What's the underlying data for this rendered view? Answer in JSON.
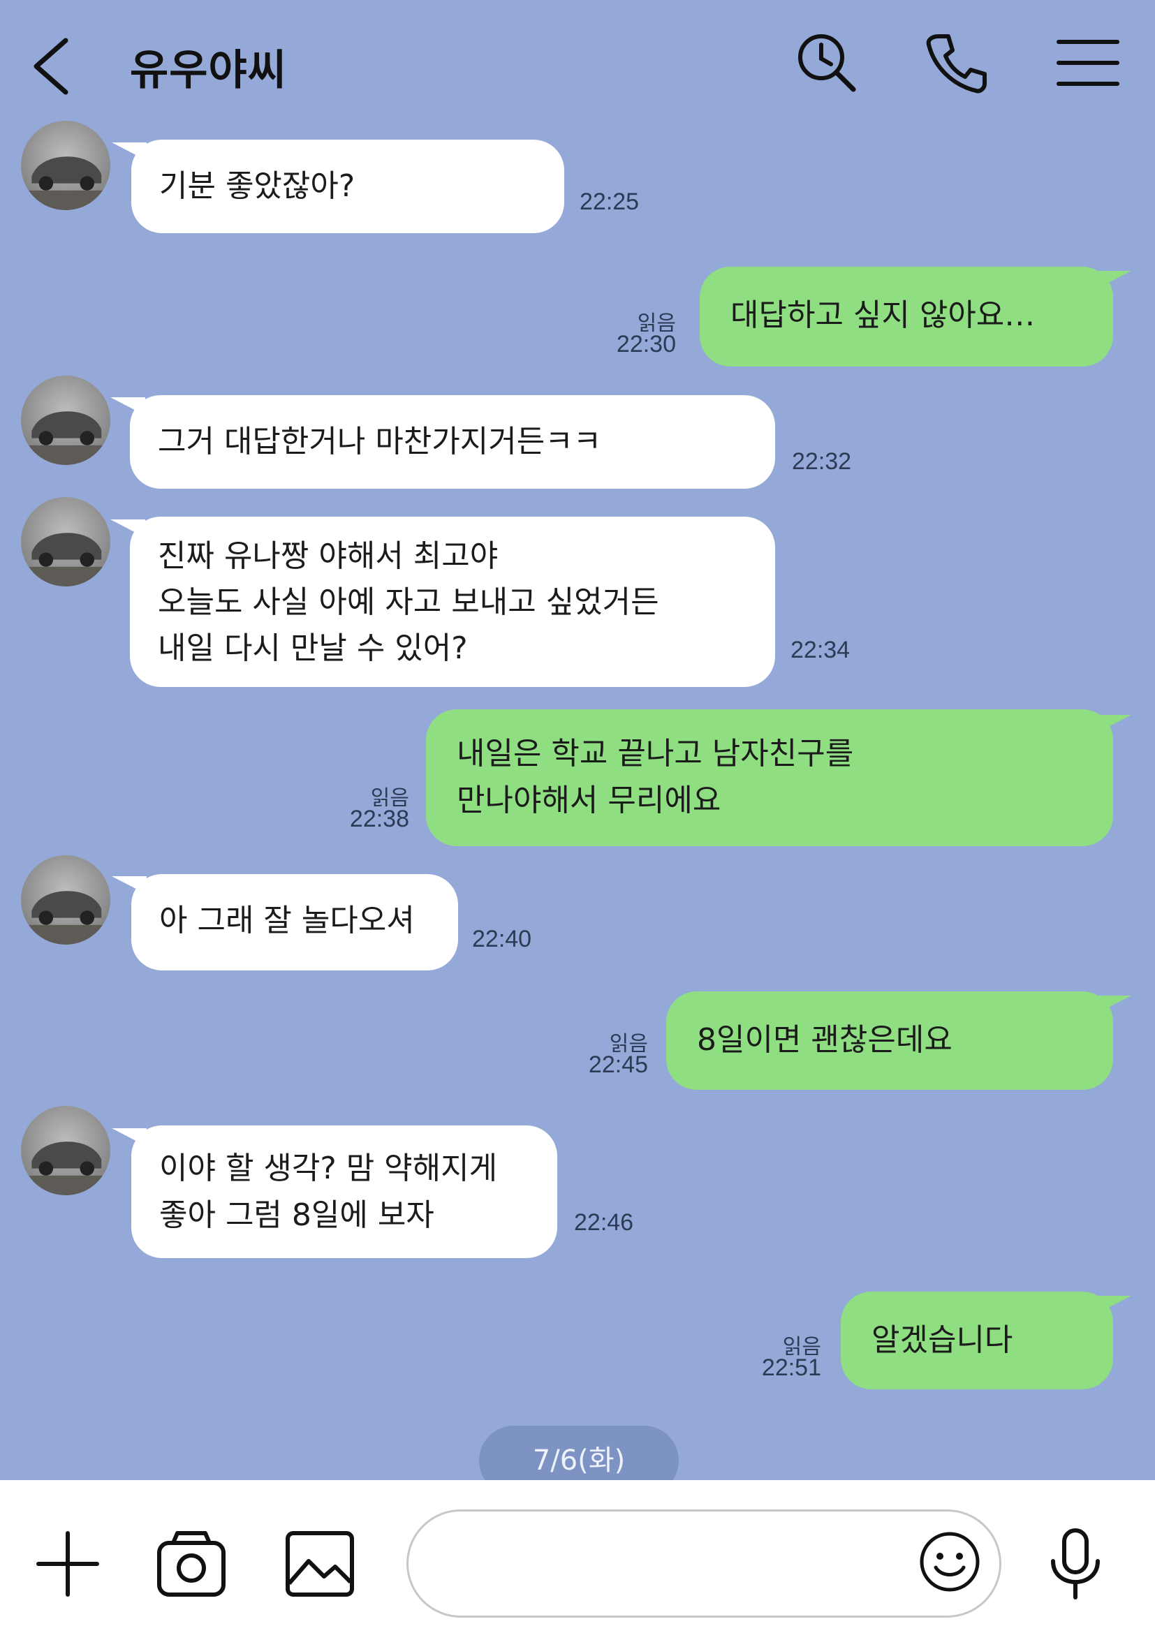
{
  "header": {
    "back_icon": "chevron-left-icon",
    "title": "유우야씨",
    "icons": [
      "search-clock-icon",
      "phone-icon",
      "menu-icon"
    ]
  },
  "messages": [
    {
      "side": "in",
      "text": "기분 좋았잖아?",
      "time": "22:25"
    },
    {
      "side": "out",
      "text": "대답하고 싶지 않아요…",
      "read": "읽음",
      "time": "22:30"
    },
    {
      "side": "in",
      "text": "그거 대답한거나 마찬가지거든ㅋㅋ",
      "time": "22:32"
    },
    {
      "side": "in",
      "text": "진짜 유나짱 야해서 최고야\n오늘도 사실 아예 자고 보내고 싶었거든\n내일 다시 만날 수 있어?",
      "time": "22:34"
    },
    {
      "side": "out",
      "text": "내일은 학교 끝나고 남자친구를\n만나야해서 무리에요",
      "read": "읽음",
      "time": "22:38"
    },
    {
      "side": "in",
      "text": "아 그래 잘 놀다오셔",
      "time": "22:40"
    },
    {
      "side": "out",
      "text": "8일이면 괜찮은데요",
      "read": "읽음",
      "time": "22:45"
    },
    {
      "side": "in",
      "text": "이야 할 생각? 맘 약해지게\n좋아 그럼 8일에 보자",
      "time": "22:46"
    },
    {
      "side": "out",
      "text": "알겠습니다",
      "read": "읽음",
      "time": "22:51"
    }
  ],
  "date_divider": "7/6(화)",
  "bottom_bar": {
    "icons": [
      "plus-icon",
      "camera-icon",
      "image-icon",
      "emoji-icon",
      "microphone-icon"
    ],
    "input_value": "",
    "input_placeholder": ""
  },
  "colors": {
    "background": "#94a9d7",
    "incoming_bubble": "#ffffff",
    "outgoing_bubble": "#8fde82",
    "date_pill": "#7d93c4"
  }
}
